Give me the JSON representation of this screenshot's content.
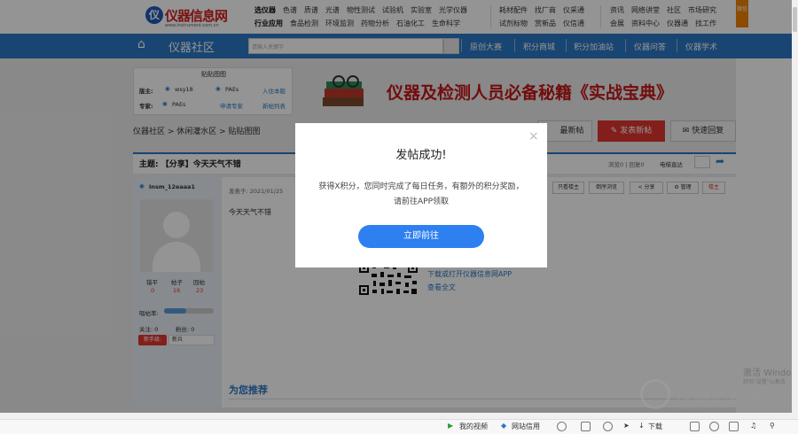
{
  "header": {
    "logo_mark": "仪",
    "logo_name": "仪器信息网",
    "logo_url": "www.instrument.com.cn",
    "row1_head": "选仪器",
    "row1": [
      "色谱",
      "质谱",
      "光谱",
      "物性测试",
      "试验机",
      "实验室",
      "光学仪器"
    ],
    "row2_head": "行业应用",
    "row2": [
      "食品检测",
      "环境监测",
      "药物分析",
      "石油化工",
      "生命科学"
    ],
    "col2_row1": [
      "耗材配件",
      "找厂商",
      "仪采通"
    ],
    "col2_row2": [
      "试剂标物",
      "赏新品",
      "仪信通"
    ],
    "col3_row1": [
      "资讯",
      "网络讲堂",
      "社区",
      "市场研究"
    ],
    "col3_row2": [
      "会展",
      "资料中心",
      "仪器通",
      "找工作"
    ],
    "orange_tab": "微信"
  },
  "nav": {
    "title": "仪器社区",
    "search_placeholder": "请输入关键字",
    "links": [
      "原创大赛",
      "积分商城",
      "积分加油站",
      "仪器问答",
      "仪器学术"
    ]
  },
  "board": {
    "title": "贴贴图图",
    "banzhu_label": "版主:",
    "banzhu": [
      "wsy18",
      "PAEs"
    ],
    "apply_moderator": "入住本版",
    "expert_label": "专家:",
    "expert": "PAEs",
    "apply_expert": "申请专家",
    "new_list": "新帖列表"
  },
  "banner": "仪器及检测人员必备秘籍《实战宝典》",
  "breadcrumb": "仪器社区 > 休闲灌水区 > 贴贴图图",
  "toolbar": {
    "latest": "最新帖",
    "post": "发表新帖",
    "quick_reply": "快速回复"
  },
  "topic": {
    "title": "主题: 【分享】今天天气不错",
    "stats": "浏览0 | 回复0",
    "guide": "电梯直达"
  },
  "user": {
    "name": "Insm_12eaaa1",
    "stats_labels": [
      "错平",
      "帖子",
      "回帖"
    ],
    "stats_values": [
      "0",
      "16",
      "23"
    ],
    "rate_label": "唱帖率:",
    "rate_value": 0.45,
    "follow": "关注: 0",
    "fans": "粉丝: 0",
    "badge": "新手级:",
    "rank": "新兵"
  },
  "post": {
    "time": "发表于: 2021/01/25",
    "content": "今天天气不错",
    "only_author": "只看楼主",
    "reverse": "倒序浏览",
    "share": "分享",
    "manage": "管理",
    "floor": "楼主",
    "app_download": "下载或打开仪器信息网APP",
    "view_full": "查看全文"
  },
  "recommend": "为您推荐",
  "watermark": {
    "line1": "激活 Windo",
    "line2": "转到\"设置\"以激活",
    "brand": "仪器信息网",
    "brand_url": "www.instrument.com.cn"
  },
  "dialog": {
    "title": "发帖成功!",
    "body": "获得X积分，您同时完成了每日任务，有额外的积分奖励，请前往APP领取",
    "button": "立即前往",
    "close": "×"
  },
  "statusbar": {
    "video": "我的视频",
    "credit": "网站信用",
    "download": "下载"
  },
  "colors": {
    "nav_blue": "#2b78c4",
    "accent_red": "#e0362f",
    "dialog_button": "#2e7ff0"
  }
}
